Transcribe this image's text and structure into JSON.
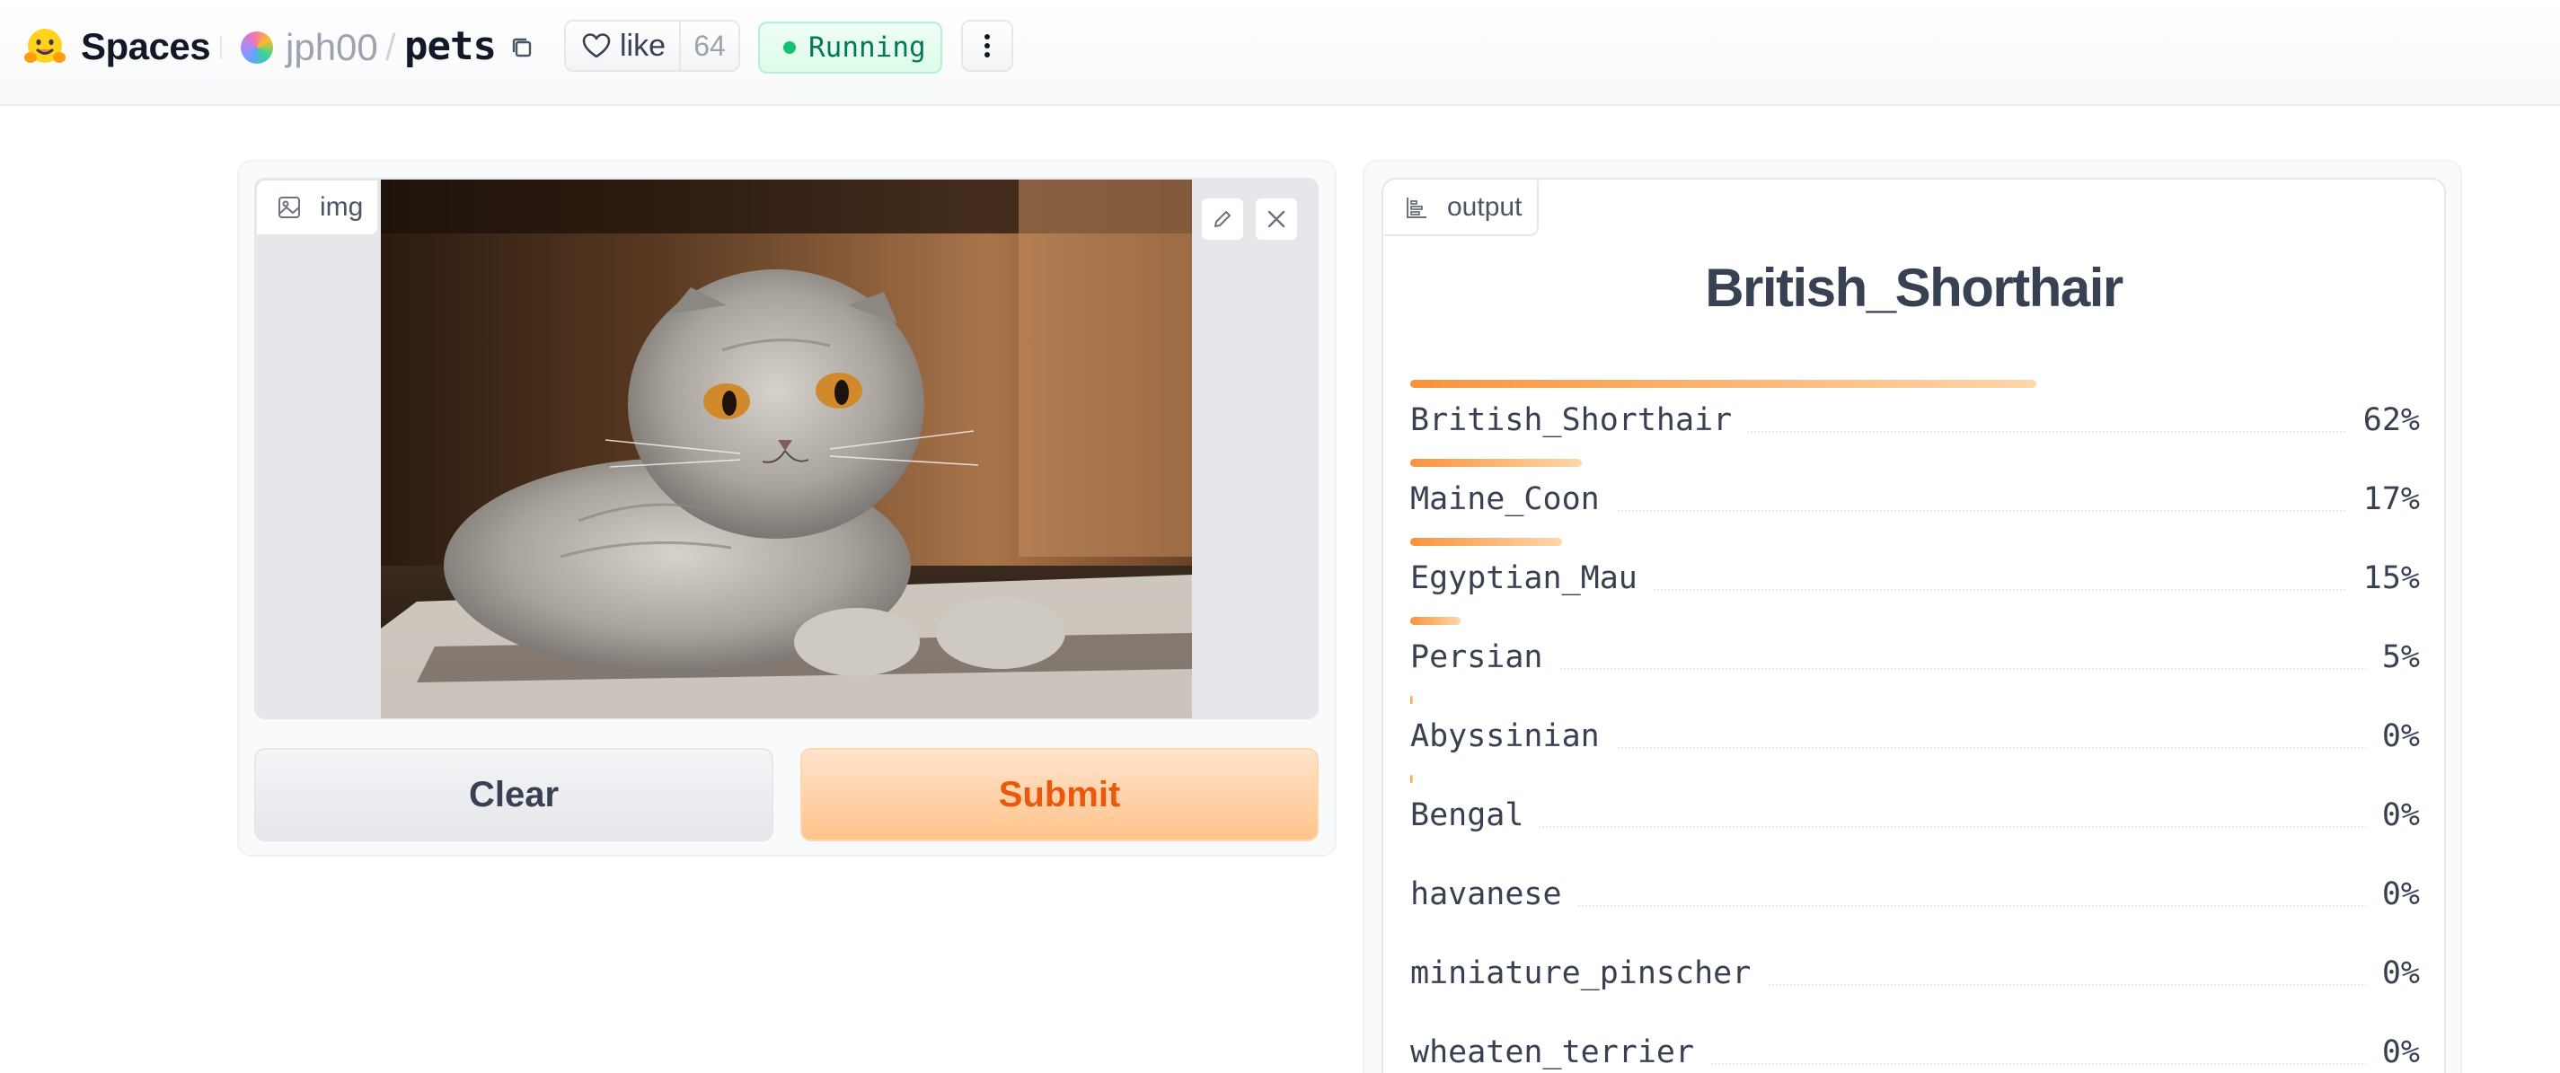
{
  "header": {
    "brand": "Spaces",
    "owner": "jph00",
    "separator": "/",
    "repo": "pets",
    "like_label": "like",
    "like_count": "64",
    "status": "Running"
  },
  "input": {
    "label": "img",
    "clear_label": "Clear",
    "submit_label": "Submit"
  },
  "output": {
    "label": "output",
    "top_prediction": "British_Shorthair",
    "confidences": [
      {
        "label": "British_Shorthair",
        "value": 0.62,
        "pct": "62%"
      },
      {
        "label": "Maine_Coon",
        "value": 0.17,
        "pct": "17%"
      },
      {
        "label": "Egyptian_Mau",
        "value": 0.15,
        "pct": "15%"
      },
      {
        "label": "Persian",
        "value": 0.05,
        "pct": "5%"
      },
      {
        "label": "Abyssinian",
        "value": 0.002,
        "pct": "0%"
      },
      {
        "label": "Bengal",
        "value": 0.001,
        "pct": "0%"
      },
      {
        "label": "havanese",
        "value": 0,
        "pct": "0%"
      },
      {
        "label": "miniature_pinscher",
        "value": 0,
        "pct": "0%"
      },
      {
        "label": "wheaten_terrier",
        "value": 0,
        "pct": "0%"
      }
    ]
  },
  "colors": {
    "accent_orange": "#ea580c",
    "status_green": "#16c172",
    "bar_gradient_start": "#fb923c"
  },
  "icons": [
    "hugging-face-logo",
    "copy-icon",
    "heart-icon",
    "more-vertical-icon",
    "image-icon",
    "pencil-icon",
    "close-icon",
    "bar-chart-icon"
  ]
}
